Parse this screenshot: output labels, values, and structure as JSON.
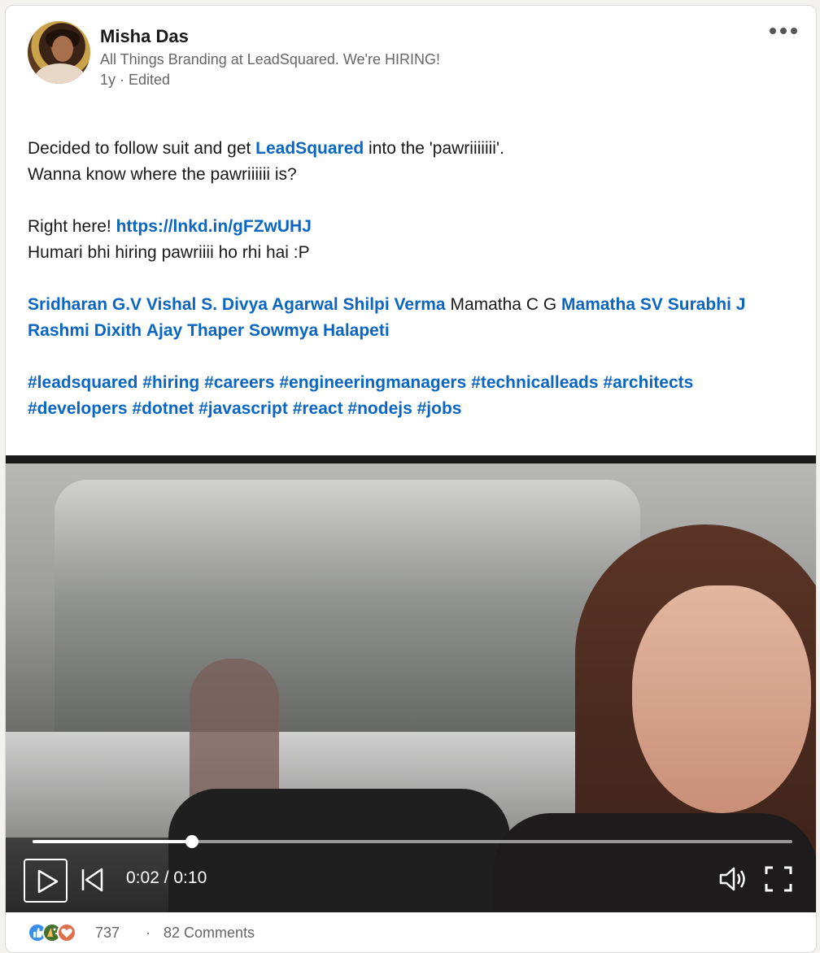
{
  "post": {
    "author": {
      "name": "Misha Das",
      "headline": "All Things Branding at LeadSquared. We're HIRING!",
      "meta": "1y · Edited"
    },
    "more_label": "...",
    "body": {
      "line1_prefix": "Decided to follow suit and get ",
      "line1_link": "LeadSquared",
      "line1_suffix": " into the 'pawriiiiiii'.",
      "line2": "Wanna know where the pawriiiiii is?",
      "line3_prefix": "Right here! ",
      "line3_link": "https://lnkd.in/gFZwUHJ",
      "line4": "Humari bhi hiring pawriiii ho rhi hai :P",
      "mentions": [
        {
          "text": "Sridharan G.V",
          "linked": true
        },
        {
          "text": "Vishal S.",
          "linked": true
        },
        {
          "text": "Divya Agarwal",
          "linked": true
        },
        {
          "text": "Shilpi Verma",
          "linked": true
        },
        {
          "text": "Mamatha C G",
          "linked": false
        },
        {
          "text": "Mamatha SV",
          "linked": true
        },
        {
          "text": "Surabhi J",
          "linked": true
        },
        {
          "text": "Rashmi Dixith",
          "linked": true
        },
        {
          "text": "Ajay Thaper",
          "linked": true
        },
        {
          "text": "Sowmya Halapeti",
          "linked": true
        }
      ],
      "hashtags_line1": [
        "#leadsquared",
        "#hiring",
        "#careers",
        "#engineeringmanagers",
        "#technicalleads",
        "#architects"
      ],
      "hashtags_line2": [
        "#developers",
        "#dotnet",
        "#javascript",
        "#react",
        "#nodejs",
        "#jobs"
      ]
    },
    "video": {
      "timecode": "0:02 / 0:10",
      "progress": 0.21,
      "icons": {
        "play": "play-icon",
        "skip": "skip-back-icon",
        "volume": "volume-icon",
        "fullscreen": "fullscreen-icon"
      }
    },
    "social": {
      "reaction_count": "737",
      "separator": "·",
      "comments": "82 Comments",
      "reactions": [
        "like-reaction-icon",
        "celebrate-reaction-icon",
        "love-reaction-icon"
      ]
    }
  },
  "colors": {
    "link": "#0a66c2",
    "text": "#191919",
    "muted": "#666666"
  }
}
